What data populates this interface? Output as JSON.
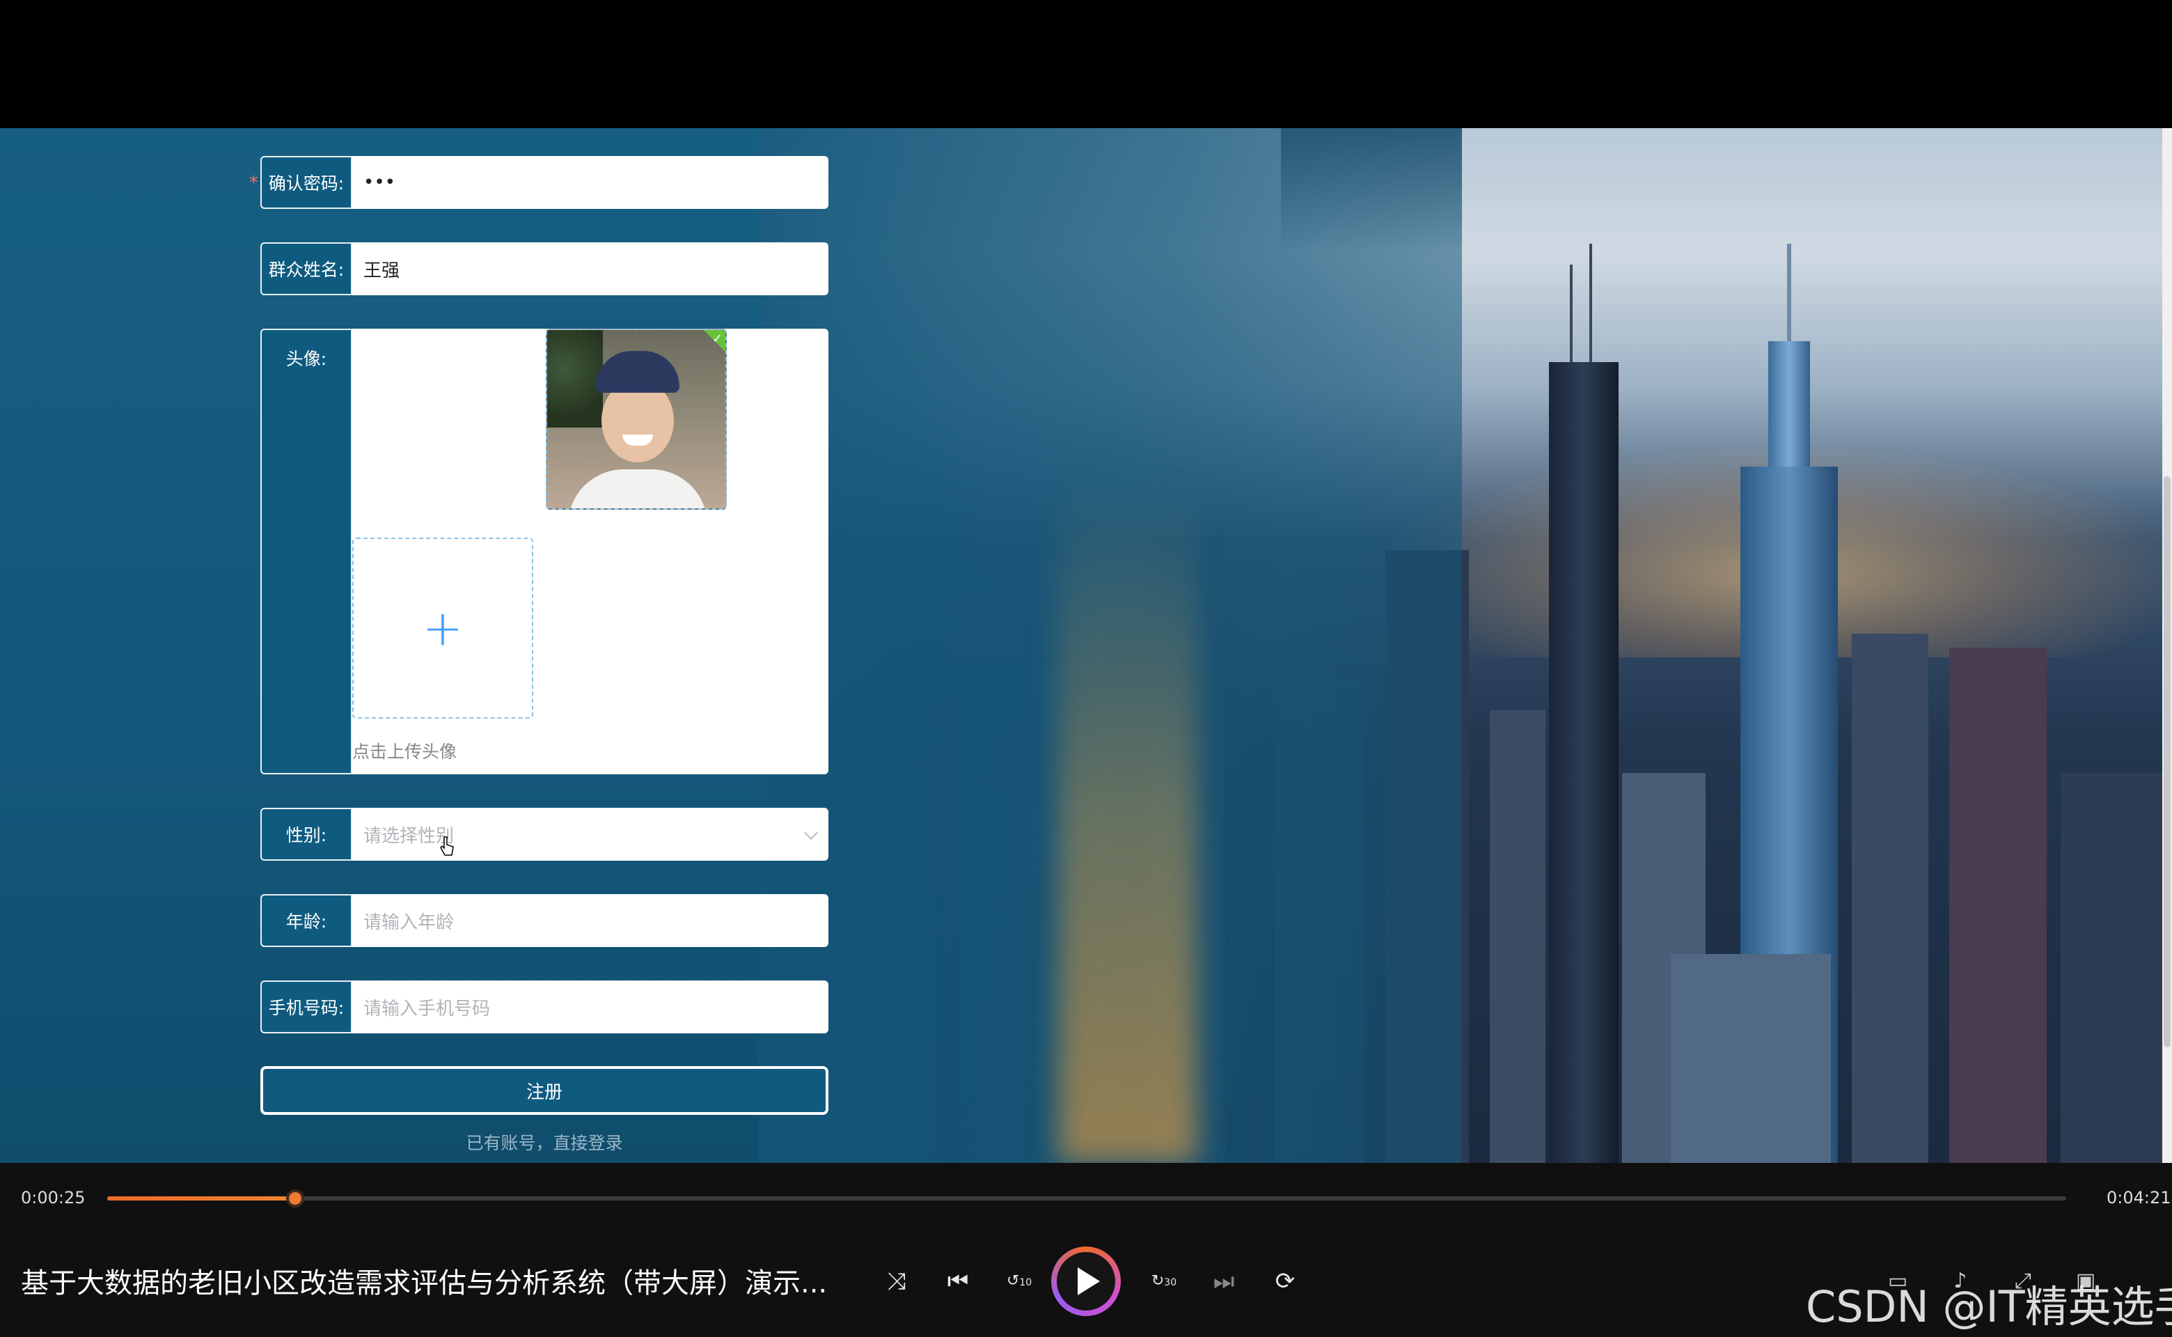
{
  "form": {
    "confirm_password": {
      "label": "确认密码:",
      "value": "•••"
    },
    "name": {
      "label": "群众姓名:",
      "value": "王强"
    },
    "avatar": {
      "label": "头像:",
      "upload_hint": "点击上传头像",
      "plus": "+"
    },
    "gender": {
      "label": "性别:",
      "placeholder": "请选择性别"
    },
    "age": {
      "label": "年龄:",
      "placeholder": "请输入年龄"
    },
    "phone": {
      "label": "手机号码:",
      "placeholder": "请输入手机号码"
    },
    "register_label": "注册",
    "login_link": "已有账号，直接登录",
    "required_mark": "*"
  },
  "player": {
    "current_time": "0:00:25",
    "total_time": "0:04:21",
    "progress_fraction": 0.096,
    "title": "基于大数据的老旧小区改造需求评估与分析系统（带大屏）演示...",
    "accent": "#f06a2a",
    "controls": {
      "shuffle": "shuffle-icon",
      "prev": "skip-previous-icon",
      "rewind": "rewind-10-icon",
      "rewind_label": "10",
      "play": "play-icon",
      "forward": "forward-30-icon",
      "forward_label": "30",
      "next": "skip-next-icon",
      "repeat": "repeat-off-icon"
    }
  },
  "watermark": "CSDN @IT精英选手"
}
